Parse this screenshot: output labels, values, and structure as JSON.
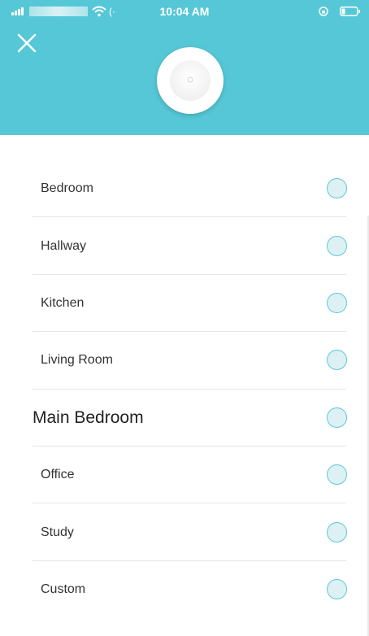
{
  "status_bar": {
    "time": "10:04 AM",
    "loading_glyph": "(·"
  },
  "header": {
    "background_color": "#56c7d6",
    "close_icon": "close-icon",
    "device_icon": "access-point-device-icon"
  },
  "list": {
    "items": [
      {
        "label": "Bedroom"
      },
      {
        "label": "Hallway"
      },
      {
        "label": "Kitchen"
      },
      {
        "label": "Living Room"
      },
      {
        "label": "Main Bedroom"
      },
      {
        "label": "Office"
      },
      {
        "label": "Study"
      },
      {
        "label": "Custom"
      }
    ],
    "radio_color": "#5ec8d7"
  }
}
